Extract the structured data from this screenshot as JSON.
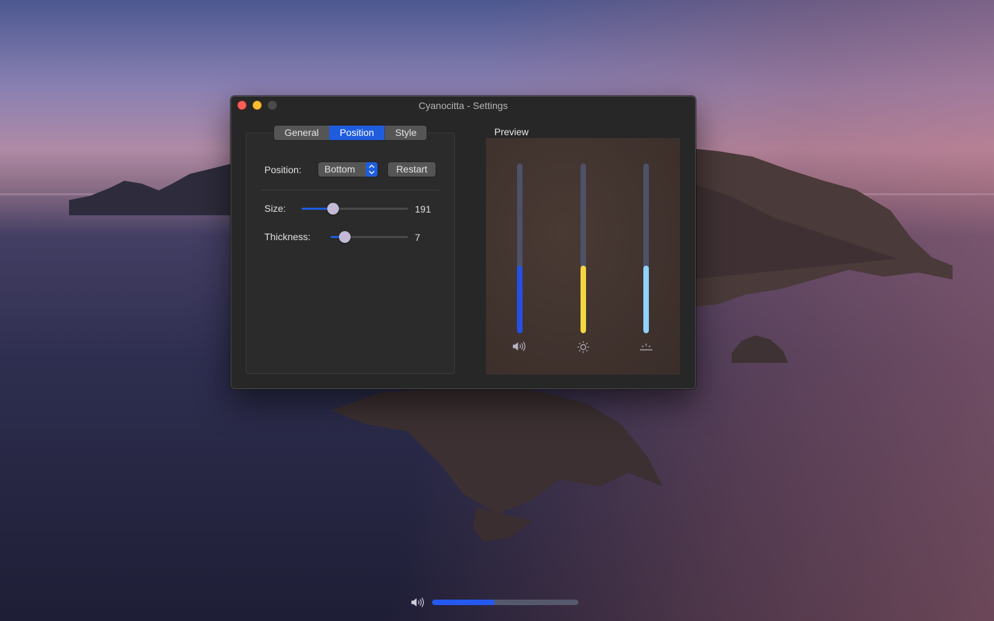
{
  "window": {
    "title": "Cyanocitta - Settings"
  },
  "tabs": [
    {
      "label": "General",
      "selected": false
    },
    {
      "label": "Position",
      "selected": true
    },
    {
      "label": "Style",
      "selected": false
    }
  ],
  "position_row": {
    "label": "Position:",
    "popup_value": "Bottom",
    "restart_label": "Restart"
  },
  "size_row": {
    "label": "Size:",
    "value_text": "191",
    "fraction": 0.29
  },
  "thickness_row": {
    "label": "Thickness:",
    "value_text": "7",
    "fraction": 0.18
  },
  "preview": {
    "label": "Preview",
    "bars": [
      {
        "icon": "speaker-volume-icon",
        "color": "#2550e6",
        "level": 0.4
      },
      {
        "icon": "brightness-sun-icon",
        "color": "#f6d542",
        "level": 0.4
      },
      {
        "icon": "keyboard-brightness-icon",
        "color": "#8fd2ff",
        "level": 0.4
      }
    ]
  },
  "hud": {
    "icon": "speaker-volume-icon",
    "level": 0.43,
    "color": "#2459f0"
  },
  "colors": {
    "accent": "#1f5dde",
    "close": "#fe5f57",
    "minimize": "#febc2e"
  }
}
